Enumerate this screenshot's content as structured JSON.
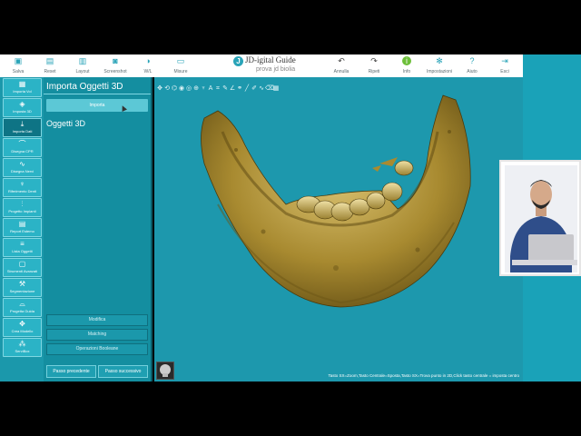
{
  "app": {
    "logo_name": "JD-igital Guide",
    "logo_tagline": "prova jd biolia"
  },
  "toolbar": {
    "left_buttons": [
      {
        "label": "Salva",
        "icon": "save-icon"
      },
      {
        "label": "Reset",
        "icon": "reset-icon"
      },
      {
        "label": "Layout",
        "icon": "layout-icon"
      },
      {
        "label": "Screenshot",
        "icon": "screenshot-icon"
      },
      {
        "label": "W/L",
        "icon": "window-level-icon"
      },
      {
        "label": "Misure",
        "icon": "ruler-icon"
      }
    ],
    "right_buttons": [
      {
        "label": "Annulla",
        "icon": "undo-icon"
      },
      {
        "label": "Ripeti",
        "icon": "redo-icon"
      },
      {
        "label": "Info",
        "icon": "info-icon"
      },
      {
        "label": "Impostazioni",
        "icon": "settings-icon"
      },
      {
        "label": "Aiuto",
        "icon": "help-icon"
      },
      {
        "label": "Esci",
        "icon": "exit-icon"
      }
    ]
  },
  "sidebar": {
    "items": [
      {
        "label": "Importa Vol",
        "icon": "volume-icon",
        "active": false
      },
      {
        "label": "Imposta 3D",
        "icon": "cube-icon",
        "active": false
      },
      {
        "label": "Importa Dati",
        "icon": "download-icon",
        "active": true
      },
      {
        "label": "Disegna CPR",
        "icon": "curve-icon",
        "active": false
      },
      {
        "label": "Disegna Nervi",
        "icon": "nerve-icon",
        "active": false
      },
      {
        "label": "Riferimento Denti",
        "icon": "tooth-icon",
        "active": false
      },
      {
        "label": "Progetto Impianti",
        "icon": "implant-icon",
        "active": false
      },
      {
        "label": "Report Estemo",
        "icon": "report-icon",
        "active": false
      },
      {
        "label": "Lista Oggetti",
        "icon": "list-icon",
        "active": false
      },
      {
        "label": "Strumenti Avanzati",
        "icon": "tools-icon",
        "active": false
      },
      {
        "label": "Segmentazione",
        "icon": "wrench-icon",
        "active": false
      },
      {
        "label": "Progetta Guida",
        "icon": "guide-icon",
        "active": false
      },
      {
        "label": "Crea Modello",
        "icon": "handshake-icon",
        "active": false
      },
      {
        "label": "ServiBox",
        "icon": "nodes-icon",
        "active": false
      }
    ]
  },
  "panel": {
    "title": "Importa Oggetti 3D",
    "import_button": "Importa",
    "objects_title": "Oggetti 3D",
    "actions": [
      "Modifica",
      "Matching",
      "Operazioni Booleane"
    ],
    "prev_button": "Passo precedente",
    "next_button": "Passo successivo"
  },
  "viewport": {
    "status_text": "Tasto SX=Zoom,Tasto Centrale=Sposta,Tasto SX=Trova punto in 2D,Click tasto centrale = imposta centro",
    "tool_icons": [
      "move-icon",
      "rotate-icon",
      "scan-icon",
      "camera-icon",
      "reset-view-icon",
      "zoom-icon",
      "tooth-view-icon",
      "text-icon",
      "crop-icon",
      "pen-icon",
      "angle-icon",
      "link-icon",
      "line-icon",
      "brush-icon",
      "curve-tool-icon",
      "eraser-icon",
      "grid-icon"
    ]
  },
  "colors": {
    "accent": "#1aa2b8",
    "sidebar": "#1b98ab",
    "panel": "#148ea0",
    "viewport": "#1d98ad",
    "bone": "#b59a3e"
  }
}
